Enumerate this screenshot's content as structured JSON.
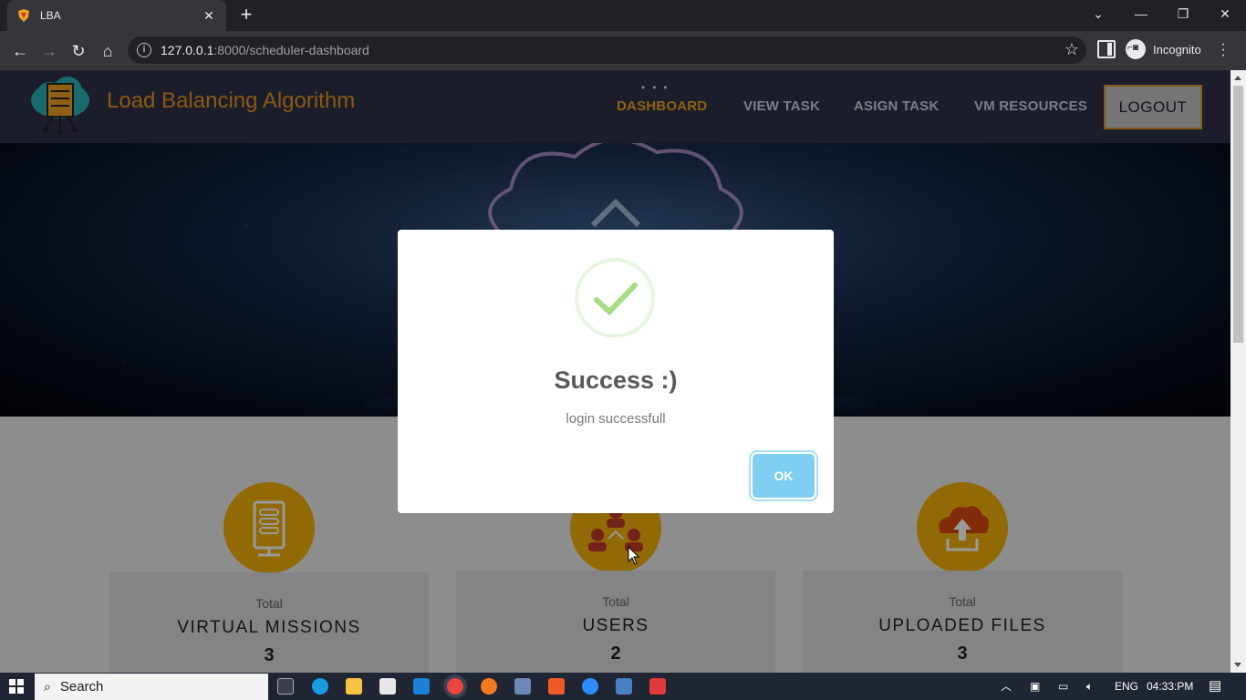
{
  "browser": {
    "tab_title": "LBA",
    "url_host": "127.0.0.1",
    "url_rest": ":8000/scheduler-dashboard",
    "profile_label": "Incognito"
  },
  "site": {
    "brand": "Load Balancing Algorithm",
    "nav": [
      "DASHBOARD",
      "VIEW TASK",
      "ASIGN TASK",
      "VM RESOURCES"
    ],
    "logout": "LOGOUT",
    "accent": "#f0a020"
  },
  "stats": [
    {
      "label": "Total",
      "title": "VIRTUAL MISSIONS",
      "value": "3",
      "icon": "server-icon"
    },
    {
      "label": "Total",
      "title": "USERS",
      "value": "2",
      "icon": "users-icon"
    },
    {
      "label": "Total",
      "title": "UPLOADED FILES",
      "value": "3",
      "icon": "cloud-upload-icon"
    }
  ],
  "modal": {
    "title": "Success :)",
    "text": "login successfull",
    "ok": "OK"
  },
  "taskbar": {
    "search": "Search",
    "lang": "ENG",
    "time": "04:33:PM"
  }
}
